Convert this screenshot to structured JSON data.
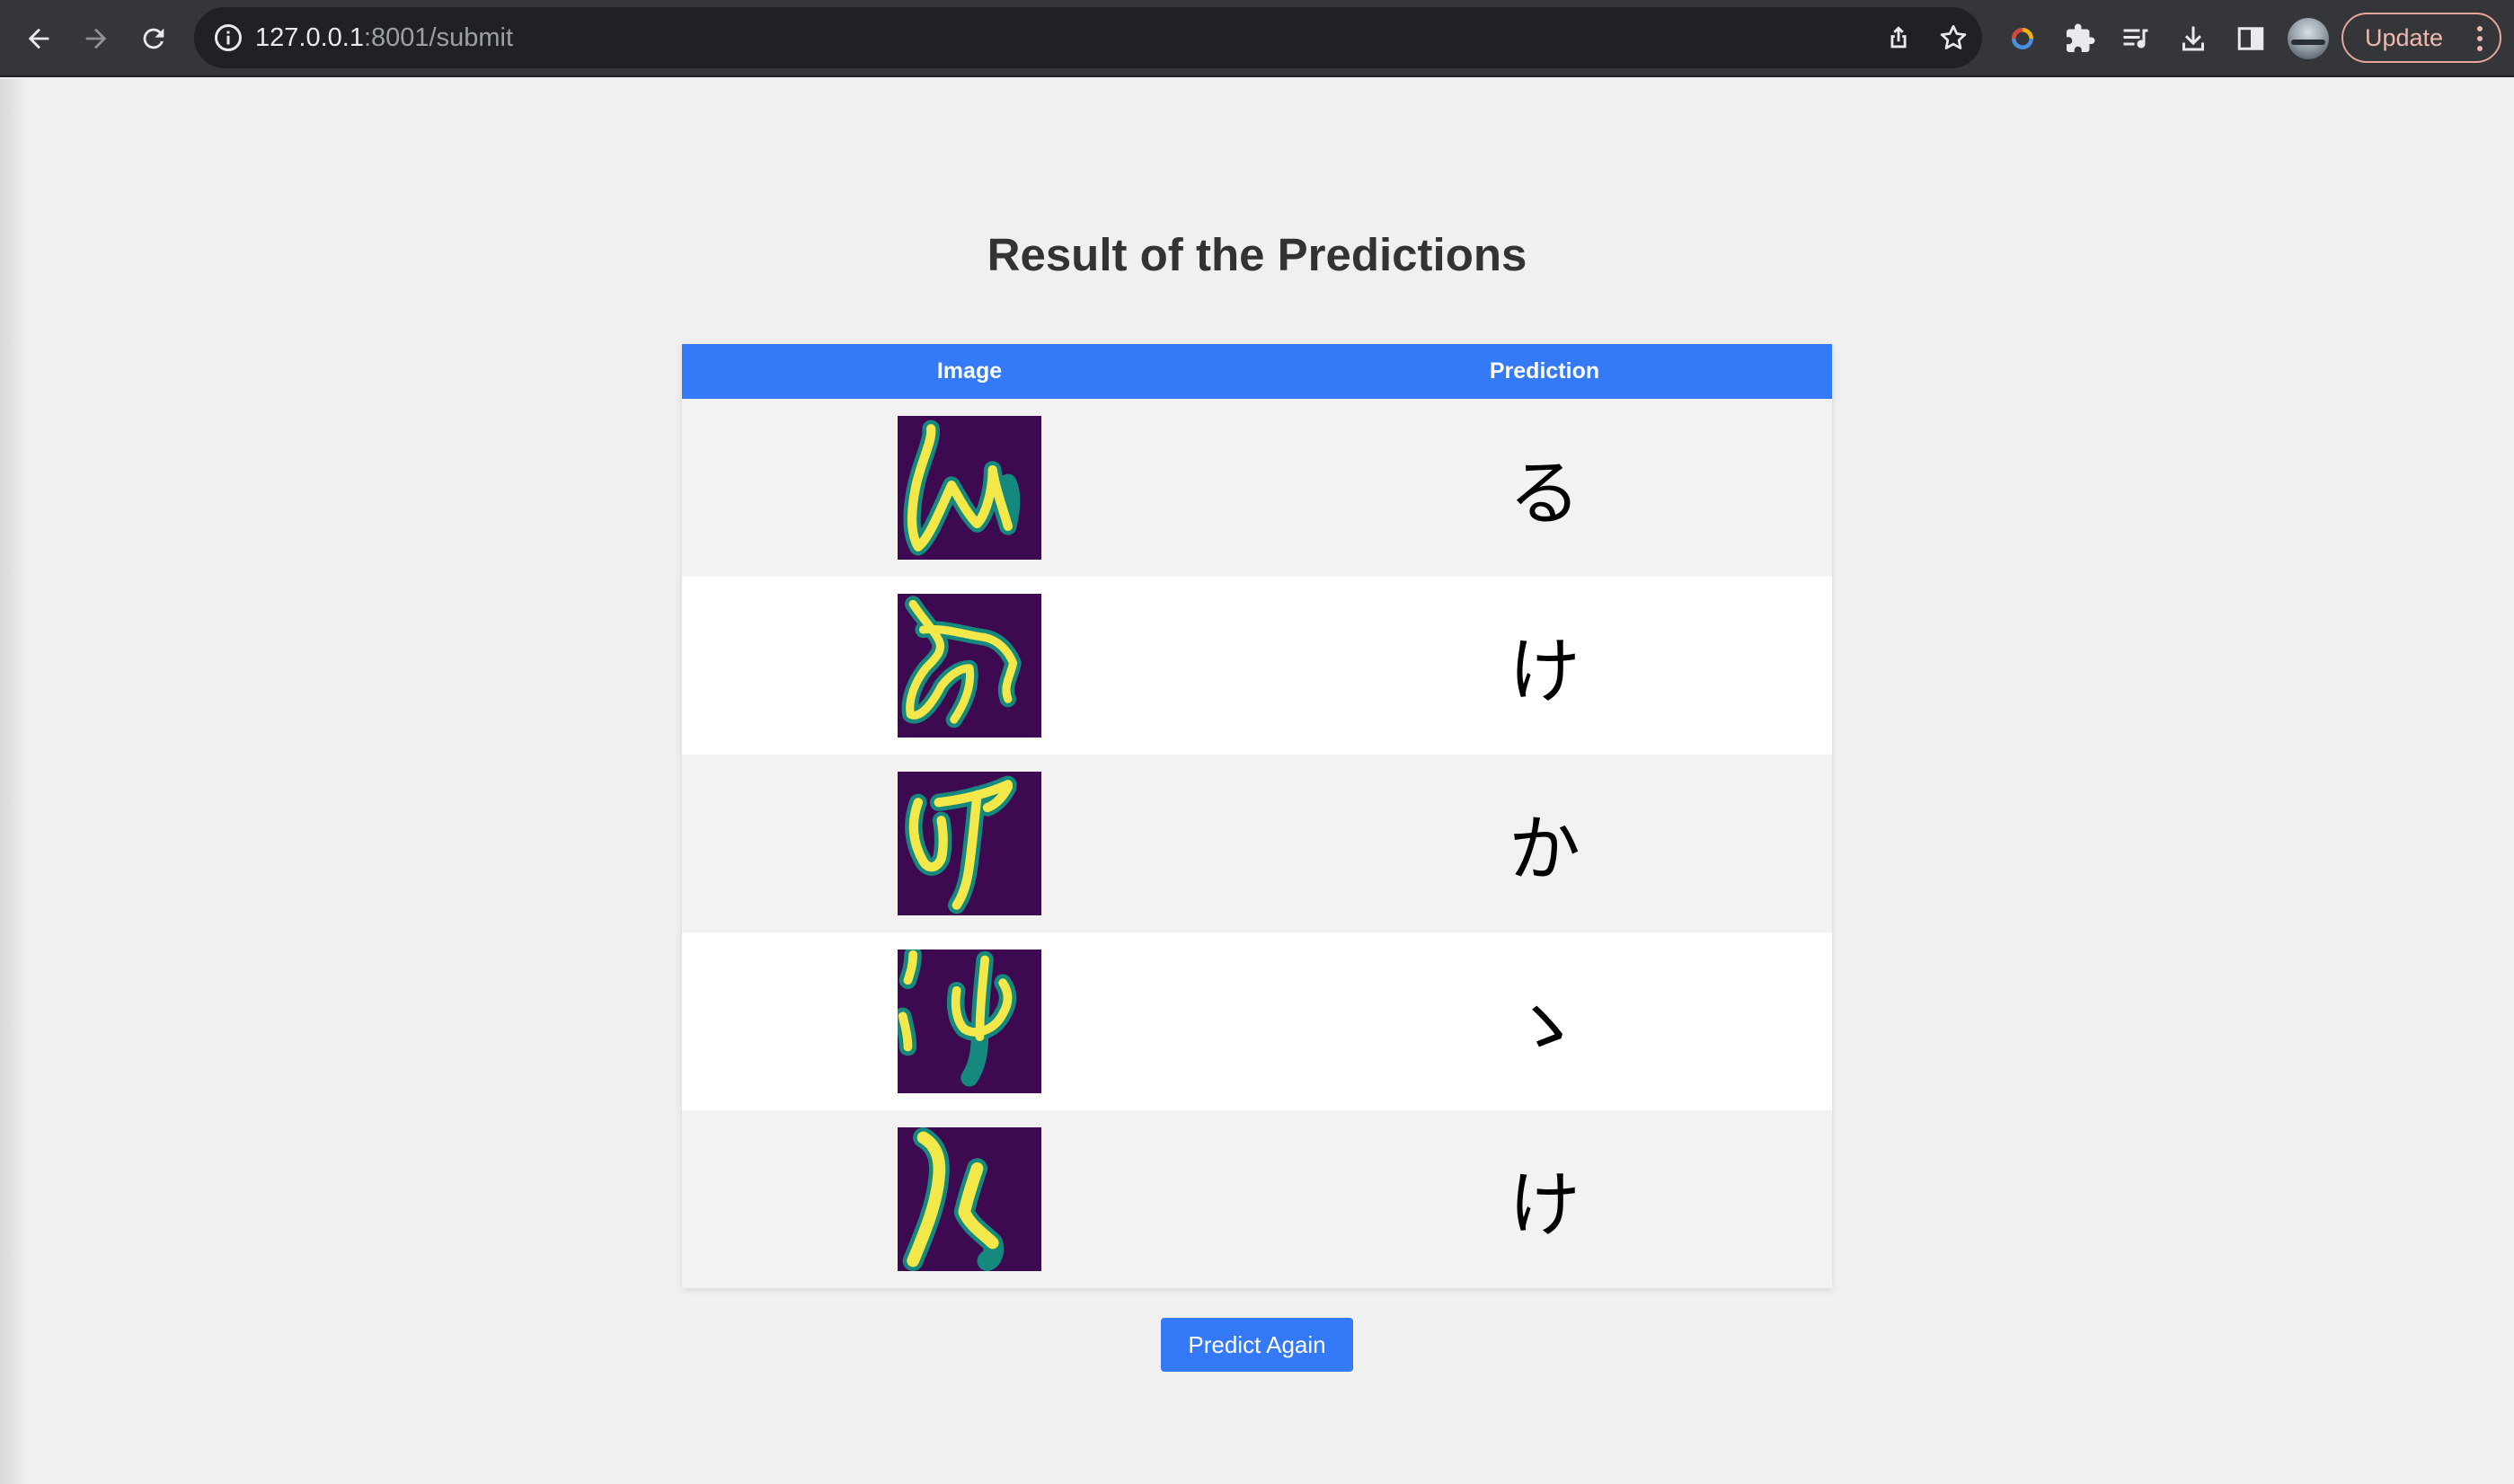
{
  "browser": {
    "url_host": "127.0.0.1",
    "url_rest": ":8001/submit",
    "update_label": "Update",
    "icons": [
      "back-arrow-icon",
      "forward-arrow-icon",
      "reload-icon",
      "info-icon",
      "share-icon",
      "bookmark-star-icon",
      "extension-color-icon",
      "puzzle-icon",
      "media-queue-icon",
      "download-icon",
      "side-panel-icon",
      "avatar",
      "menu-dots-icon"
    ]
  },
  "page": {
    "title": "Result of the Predictions",
    "table": {
      "headers": [
        "Image",
        "Prediction"
      ],
      "rows": [
        {
          "prediction": "る"
        },
        {
          "prediction": "け"
        },
        {
          "prediction": "か"
        },
        {
          "prediction": "ゝ"
        },
        {
          "prediction": "け"
        }
      ]
    },
    "predict_again_label": "Predict Again"
  },
  "colors": {
    "accent": "#3479f6",
    "thumbnail_background": "#3d0a52",
    "thumbnail_stroke": "#f2e84a"
  }
}
